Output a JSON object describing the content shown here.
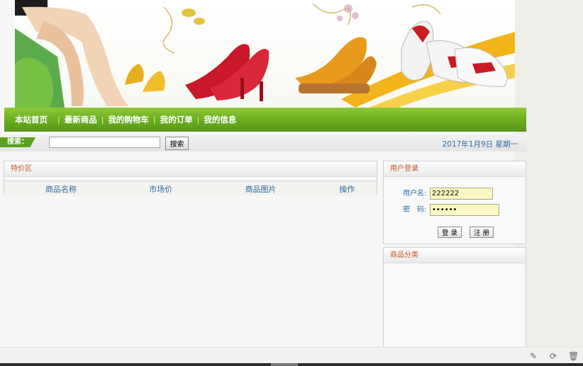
{
  "nav": {
    "items": [
      {
        "label": "本站首页"
      },
      {
        "label": "最新商品"
      },
      {
        "label": "我的购物车"
      },
      {
        "label": "我的订单"
      },
      {
        "label": "我的信息"
      }
    ]
  },
  "search": {
    "label": "搜索：",
    "value": "",
    "button": "搜索"
  },
  "date": "2017年1月9日 星期一",
  "specials": {
    "title": "特价区",
    "columns": [
      "商品名称",
      "市场价",
      "商品图片",
      "操作"
    ]
  },
  "login": {
    "title": "用户登录",
    "username_label": "用户名:",
    "username_value": "222222",
    "password_label": "密　码:",
    "password_value": "••••••",
    "login_button": "登 录",
    "register_button": "注 册"
  },
  "category": {
    "title": "商品分类"
  },
  "icons": {
    "tray": [
      "pin-icon",
      "refresh-icon",
      "trash-icon"
    ]
  },
  "colors": {
    "nav_green": "#6aac1e",
    "heading_orange": "#c8531a",
    "link_blue": "#2b6aa6",
    "input_yellow": "#fbf7c2"
  }
}
